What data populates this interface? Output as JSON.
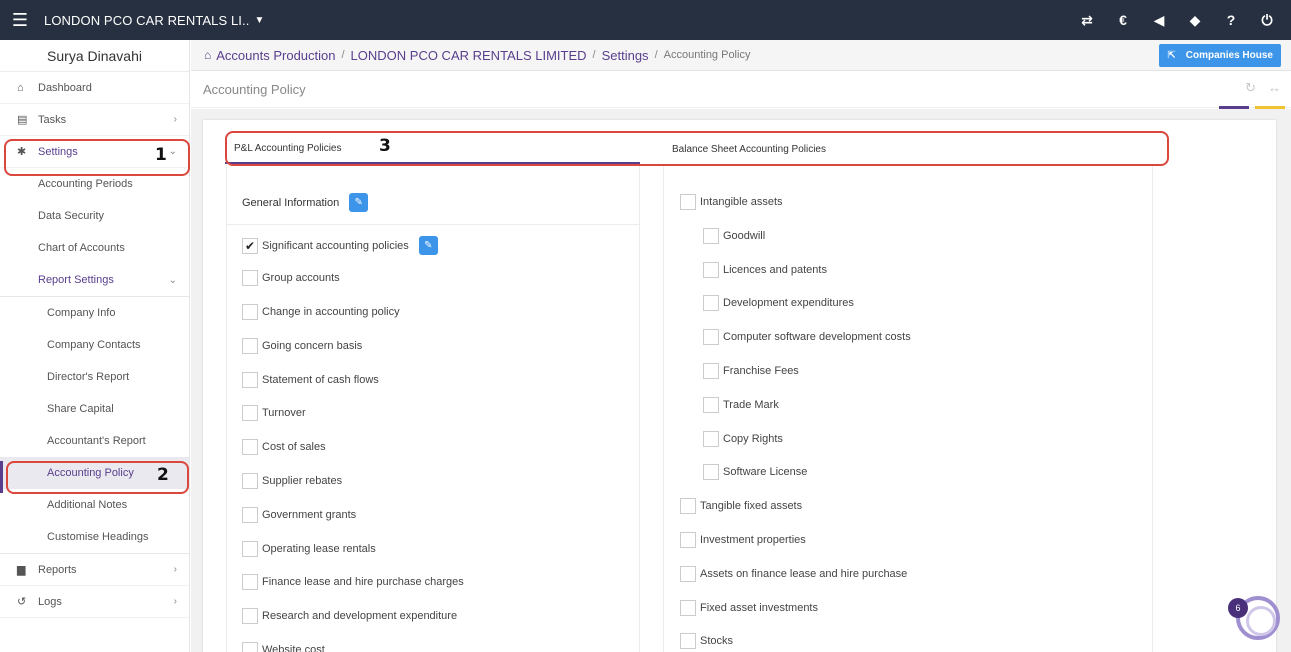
{
  "topbar": {
    "company_name": "LONDON PCO CAR RENTALS LI..",
    "icons": [
      "transfer-icon",
      "currency-icon",
      "megaphone-icon",
      "tag-icon",
      "help-icon",
      "power-icon"
    ],
    "glyphs": [
      "⇄",
      "€",
      "📢",
      "◆",
      "?",
      "⏻"
    ]
  },
  "sidebar": {
    "user_name": "Surya Dinavahi",
    "dashboard": "Dashboard",
    "tasks": "Tasks",
    "settings": "Settings",
    "accounting_periods": "Accounting Periods",
    "data_security": "Data Security",
    "chart_of_accounts": "Chart of Accounts",
    "report_settings": "Report Settings",
    "report_sub": [
      "Company Info",
      "Company Contacts",
      "Director's Report",
      "Share Capital",
      "Accountant's Report",
      "Accounting Policy",
      "Additional Notes",
      "Customise Headings"
    ],
    "reports": "Reports",
    "logs": "Logs"
  },
  "breadcrumb": {
    "items": [
      "Accounts Production",
      "LONDON PCO CAR RENTALS LIMITED",
      "Settings"
    ],
    "current": "Accounting Policy",
    "companies_house": "Companies House"
  },
  "page": {
    "title": "Accounting Policy"
  },
  "tabs": {
    "pl": "P&L Accounting Policies",
    "bs": "Balance Sheet Accounting Policies"
  },
  "pl": {
    "general_info": "General Information",
    "items": [
      {
        "label": "Significant accounting policies",
        "checked": true
      },
      {
        "label": "Group accounts",
        "checked": false
      },
      {
        "label": "Change in accounting policy",
        "checked": false
      },
      {
        "label": "Going concern basis",
        "checked": false
      },
      {
        "label": "Statement of cash flows",
        "checked": false
      },
      {
        "label": "Turnover",
        "checked": false
      },
      {
        "label": "Cost of sales",
        "checked": false
      },
      {
        "label": "Supplier rebates",
        "checked": false
      },
      {
        "label": "Government grants",
        "checked": false
      },
      {
        "label": "Operating lease rentals",
        "checked": false
      },
      {
        "label": "Finance lease and hire purchase charges",
        "checked": false
      },
      {
        "label": "Research and development expenditure",
        "checked": false
      },
      {
        "label": "Website cost",
        "checked": false
      }
    ]
  },
  "bs": {
    "items": [
      {
        "label": "Intangible assets",
        "checked": false,
        "indent": false
      },
      {
        "label": "Goodwill",
        "checked": false,
        "indent": true
      },
      {
        "label": "Licences and patents",
        "checked": false,
        "indent": true
      },
      {
        "label": "Development expenditures",
        "checked": false,
        "indent": true
      },
      {
        "label": "Computer software development costs",
        "checked": false,
        "indent": true
      },
      {
        "label": "Franchise Fees",
        "checked": false,
        "indent": true
      },
      {
        "label": "Trade Mark",
        "checked": false,
        "indent": true
      },
      {
        "label": "Copy Rights",
        "checked": false,
        "indent": true
      },
      {
        "label": "Software License",
        "checked": false,
        "indent": true
      },
      {
        "label": "Tangible fixed assets",
        "checked": false,
        "indent": false
      },
      {
        "label": "Investment properties",
        "checked": false,
        "indent": false
      },
      {
        "label": "Assets on finance lease and hire purchase",
        "checked": false,
        "indent": false
      },
      {
        "label": "Fixed asset investments",
        "checked": false,
        "indent": false
      },
      {
        "label": "Stocks",
        "checked": false,
        "indent": false
      }
    ]
  },
  "annotations": [
    "1",
    "2",
    "3"
  ],
  "chat": {
    "badge": "6"
  }
}
